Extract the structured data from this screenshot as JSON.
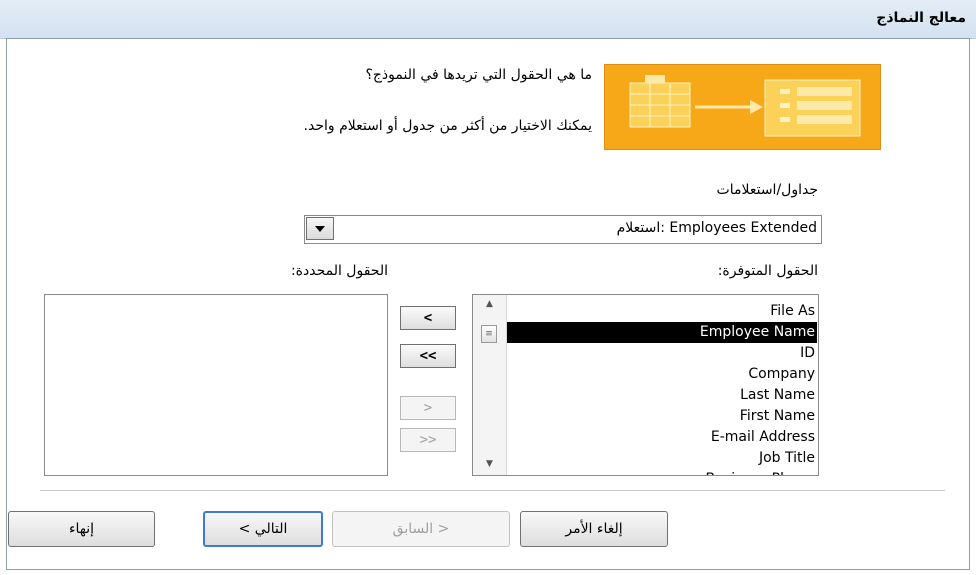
{
  "window": {
    "title": "معالج النماذج"
  },
  "intro": {
    "question": "ما هي الحقول التي تريدها في النموذج؟",
    "hint": "يمكنك الاختيار من أكثر من جدول أو استعلام واحد."
  },
  "tables_label": "جداول/استعلامات",
  "tables_combo": {
    "value": "استعلام: Employees Extended"
  },
  "available_label": "الحقول المتوفرة:",
  "selected_label": "الحقول المحددة:",
  "available_fields": [
    {
      "label": "File As",
      "selected": false
    },
    {
      "label": "Employee Name",
      "selected": true
    },
    {
      "label": "ID",
      "selected": false
    },
    {
      "label": "Company",
      "selected": false
    },
    {
      "label": "Last Name",
      "selected": false
    },
    {
      "label": "First Name",
      "selected": false
    },
    {
      "label": "E-mail Address",
      "selected": false
    },
    {
      "label": "Job Title",
      "selected": false
    },
    {
      "label": "Business Phone",
      "selected": false
    }
  ],
  "move_buttons": {
    "add_one": "<",
    "add_all": "<<",
    "remove_one": ">",
    "remove_all": ">>"
  },
  "footer": {
    "cancel": "إلغاء الأمر",
    "back": "< السابق",
    "next": "التالي >",
    "finish": "إنهاء"
  },
  "colors": {
    "banner": "#f7a818",
    "selection": "#000000",
    "primary_border": "#3d7bd0"
  }
}
